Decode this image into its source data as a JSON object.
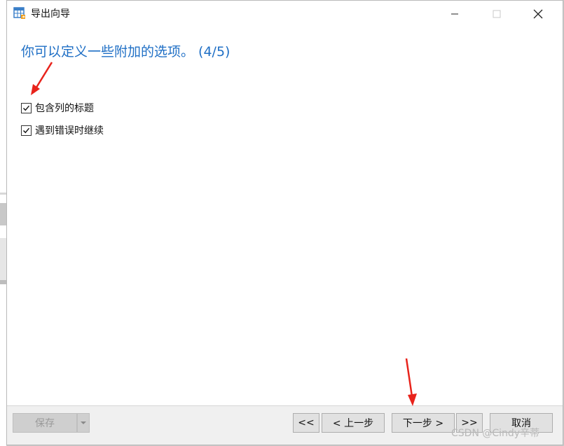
{
  "window": {
    "title": "导出向导"
  },
  "page": {
    "heading": "你可以定义一些附加的选项。 (4/5)"
  },
  "options": [
    {
      "label": "包含列的标题",
      "checked": true
    },
    {
      "label": "遇到错误时继续",
      "checked": true
    }
  ],
  "footer": {
    "save_label": "保存",
    "first_label": "<<",
    "prev_label": "< 上一步",
    "next_label": "下一步 >",
    "last_label": ">>",
    "cancel_label": "取消"
  },
  "watermark": "CSDN @Cindy辛蒂",
  "colors": {
    "heading": "#1f6fc5",
    "annotation_arrow": "#e8231b",
    "footer_bg": "#f0f0f0"
  }
}
